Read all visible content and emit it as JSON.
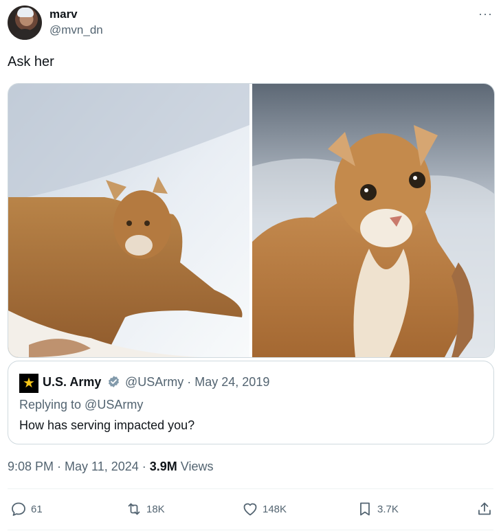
{
  "author": {
    "name": "marv",
    "handle": "@mvn_dn",
    "more_icon": "more-horizontal-icon"
  },
  "tweet": {
    "text": "Ask her"
  },
  "media": {
    "images": [
      {
        "description": "mountain-lion-in-snow-left"
      },
      {
        "description": "mountain-lion-in-snow-right"
      }
    ]
  },
  "quoted_tweet": {
    "name": "U.S. Army",
    "verified": true,
    "meta": "@USArmy · May 24, 2019",
    "replying_to": "Replying to @USArmy",
    "text": "How has serving impacted you?"
  },
  "timestamp": {
    "time_date": "9:08 PM · May 11, 2024 · ",
    "views_count": "3.9M",
    "views_label": " Views"
  },
  "actions": {
    "replies": "61",
    "retweets": "18K",
    "likes": "148K",
    "bookmarks": "3.7K"
  },
  "colors": {
    "text": "#0f1419",
    "secondary": "#536471",
    "border": "#cfd9de",
    "verified": "#829aab",
    "army_gold": "#f5c518"
  }
}
